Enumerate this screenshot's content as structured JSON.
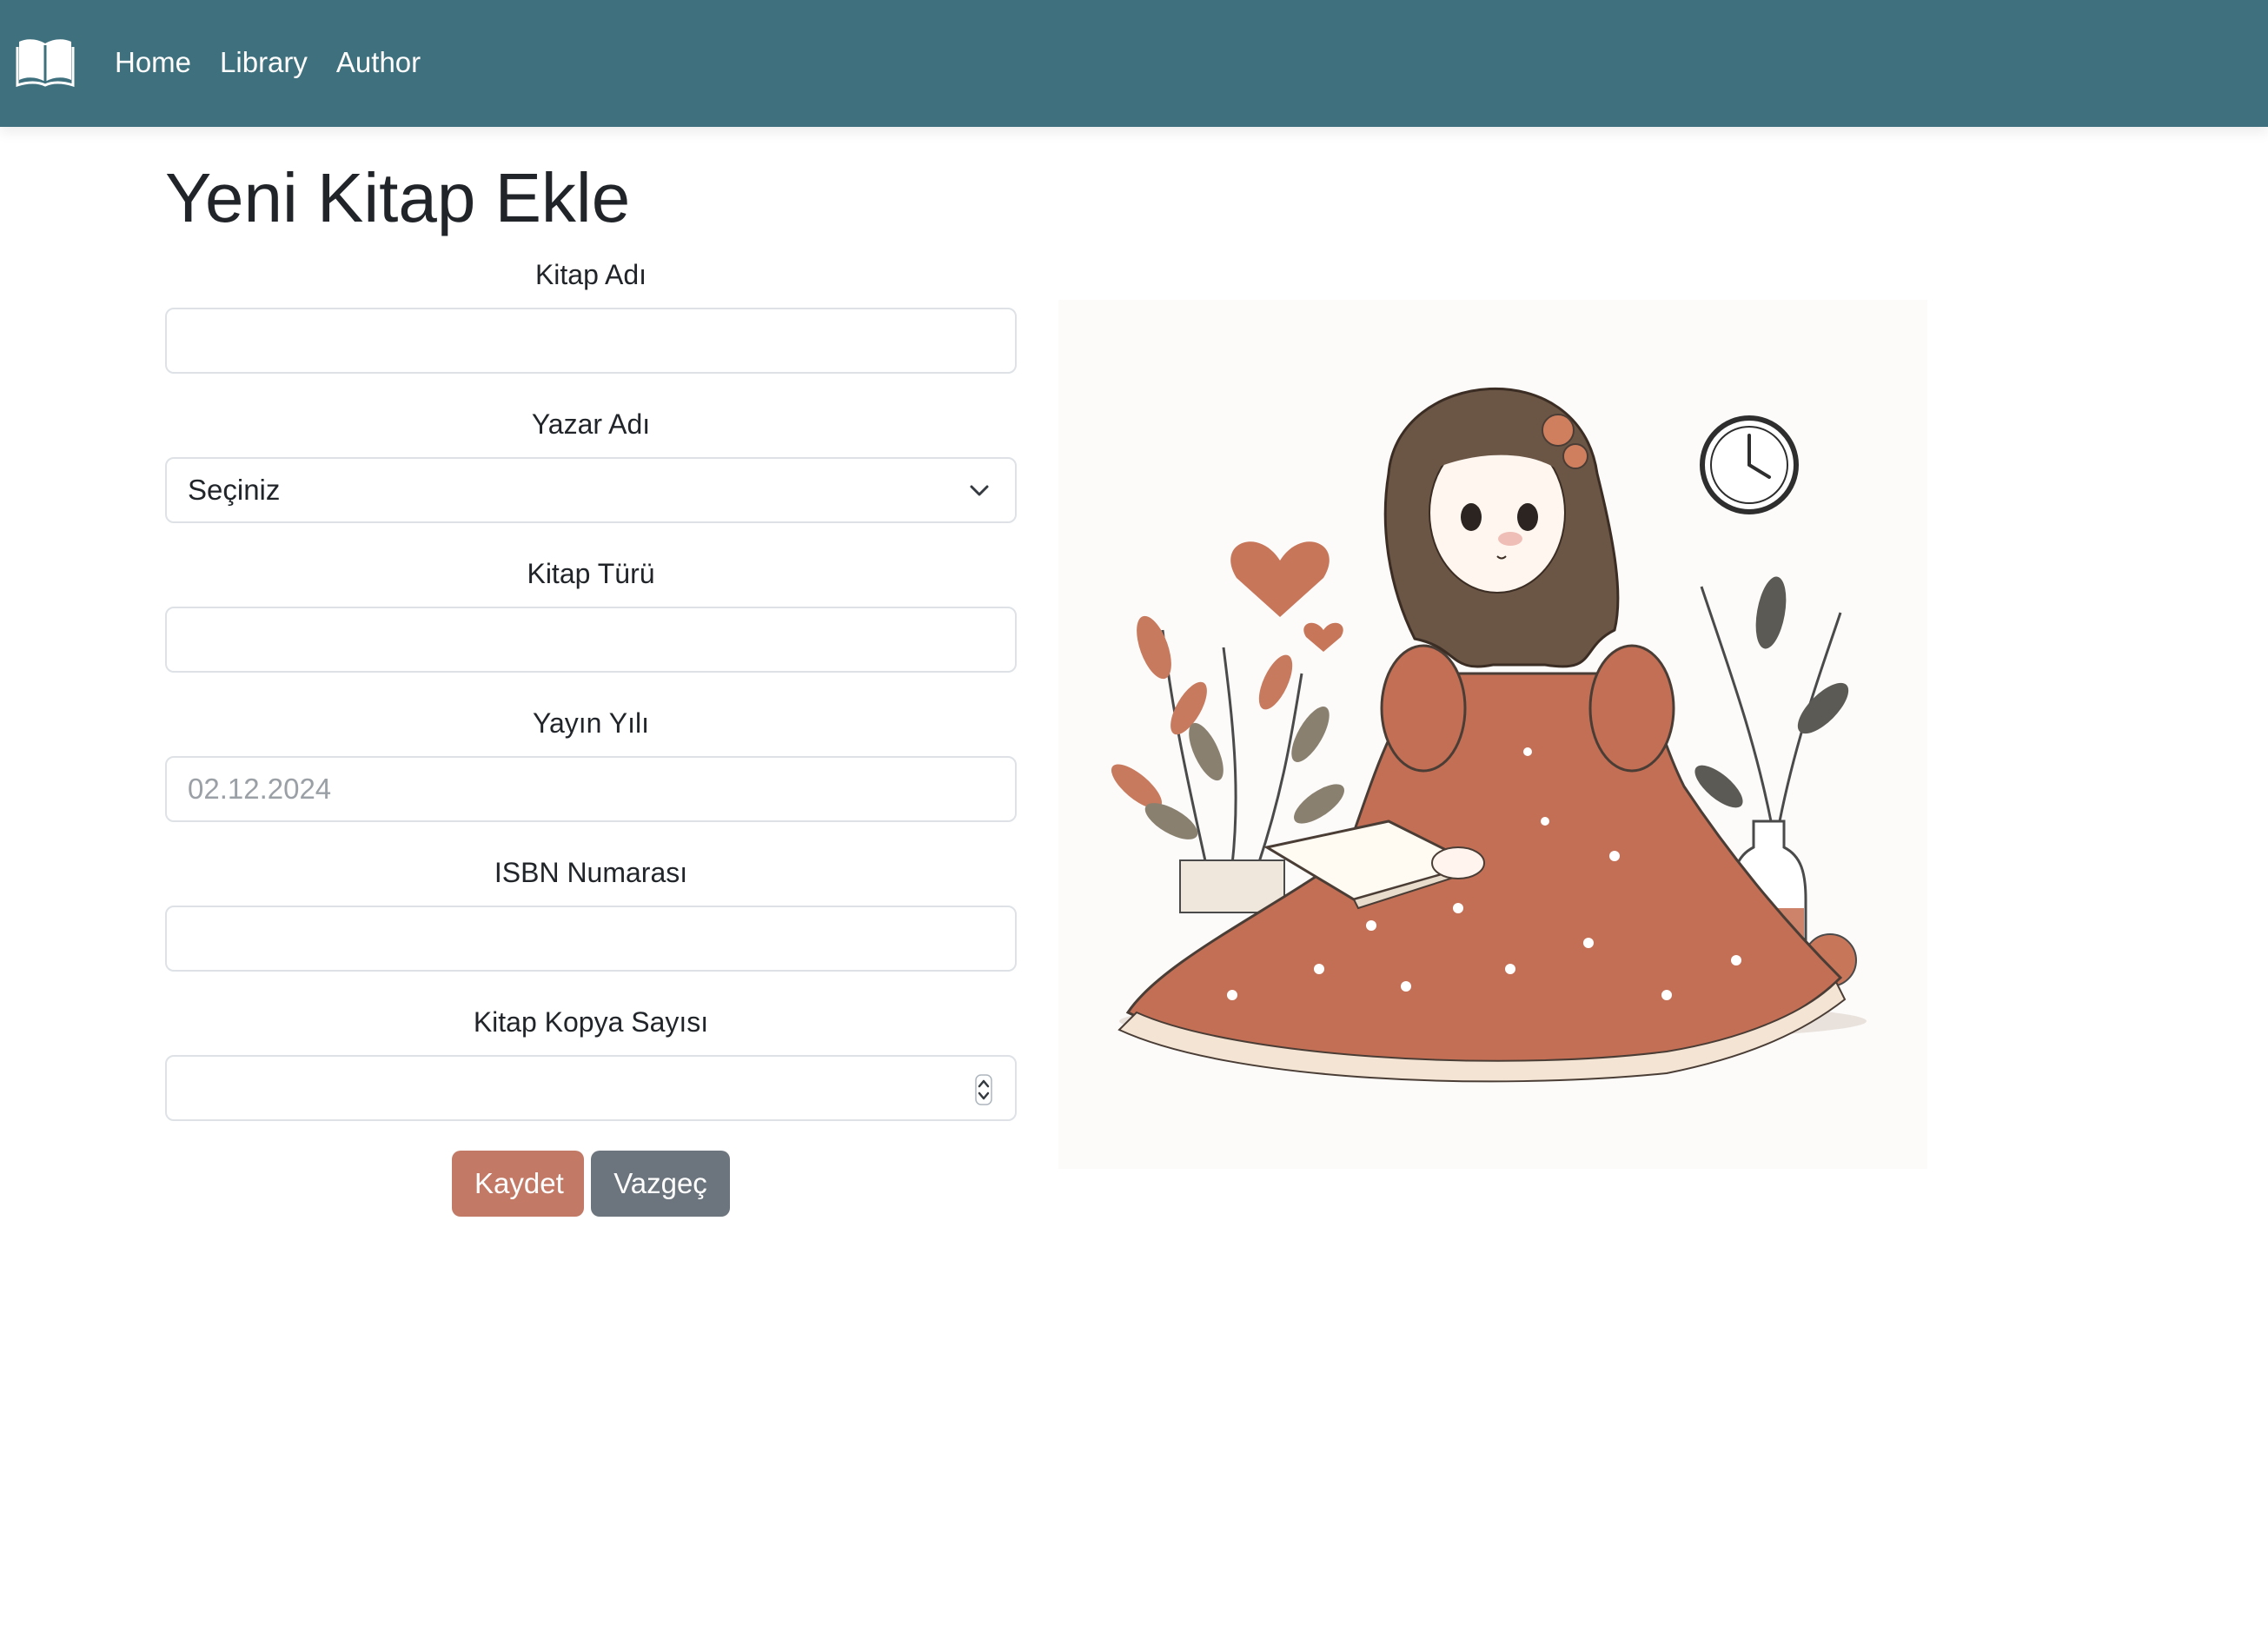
{
  "nav": {
    "brand_icon": "open-book-icon",
    "links": [
      "Home",
      "Library",
      "Author"
    ]
  },
  "page": {
    "title": "Yeni Kitap Ekle"
  },
  "form": {
    "book_name": {
      "label": "Kitap Adı",
      "value": ""
    },
    "author": {
      "label": "Yazar Adı",
      "selected": "Seçiniz"
    },
    "genre": {
      "label": "Kitap Türü",
      "value": ""
    },
    "year": {
      "label": "Yayın Yılı",
      "placeholder": "02.12.2024"
    },
    "isbn": {
      "label": "ISBN Numarası",
      "value": ""
    },
    "copies": {
      "label": "Kitap Kopya Sayısı",
      "value": ""
    }
  },
  "buttons": {
    "save": "Kaydet",
    "cancel": "Vazgeç"
  },
  "colors": {
    "navbar": "#3e707e",
    "save_button": "#c27a66",
    "cancel_button": "#6c757d"
  },
  "illustration": {
    "subject": "girl-reading-book-illustration"
  }
}
